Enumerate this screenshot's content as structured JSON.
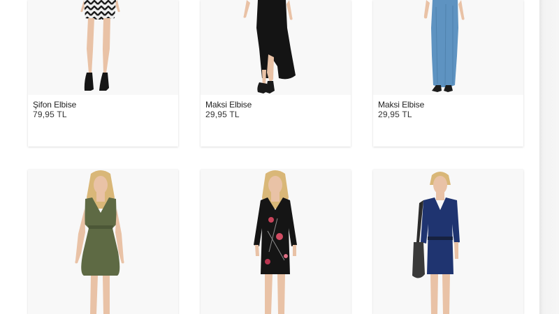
{
  "products": [
    {
      "name": "Şifon Elbise",
      "price": "79,95 TL",
      "dress_color": "#2a2a2a",
      "pattern": "chevron"
    },
    {
      "name": "Maksi Elbise",
      "price": "29,95 TL",
      "dress_color": "#141414",
      "pattern": "maxi-black"
    },
    {
      "name": "Maksi Elbise",
      "price": "29,95 TL",
      "dress_color": "#5e93c1",
      "pattern": "maxi-blue"
    },
    {
      "name": "",
      "price": "",
      "dress_color": "#5e6a44",
      "pattern": "olive"
    },
    {
      "name": "",
      "price": "",
      "dress_color": "#151515",
      "pattern": "floral"
    },
    {
      "name": "",
      "price": "",
      "dress_color": "#1f3470",
      "pattern": "navy"
    }
  ],
  "colors": {
    "background": "#ffffff",
    "card": "#ffffff",
    "photo_bg": "#f8f8f8",
    "skin": "#e9c2a6",
    "hair": "#d9b778"
  }
}
